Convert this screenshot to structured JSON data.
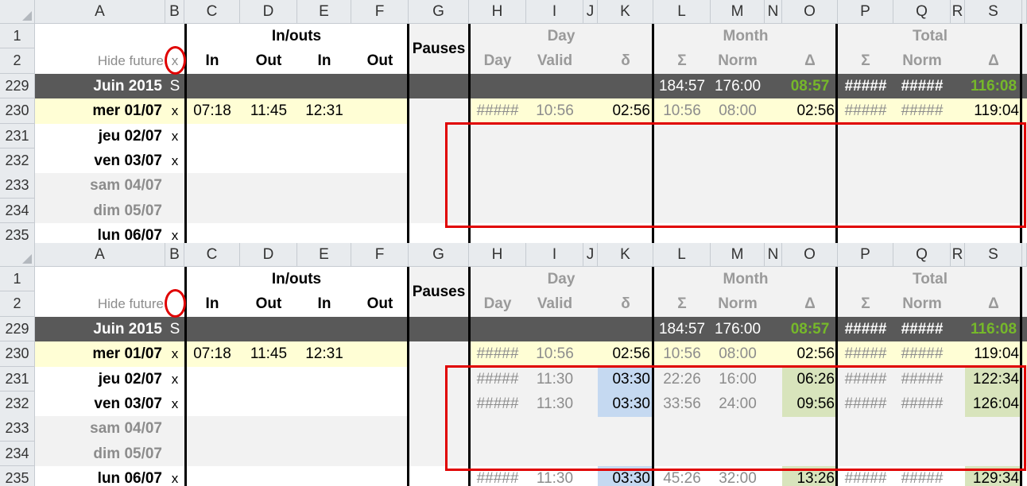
{
  "colors": {
    "header_bg": "#e8ebee",
    "dark_row": "#595959",
    "yellow_row": "#fffed5",
    "weekend_row": "#f2f2f2",
    "blue_cell": "#c5d9f1",
    "green_cell": "#d8e4bc",
    "green_text": "#76b82a",
    "highlight_red": "#e00000"
  },
  "columns": [
    "A",
    "B",
    "C",
    "D",
    "E",
    "F",
    "G",
    "H",
    "I",
    "J",
    "K",
    "L",
    "M",
    "N",
    "O",
    "P",
    "Q",
    "R",
    "S"
  ],
  "header": {
    "inouts": "In/outs",
    "pauses": "Pauses",
    "day": "Day",
    "month": "Month",
    "total": "Total",
    "hide_future": "Hide future",
    "in": "In",
    "out": "Out",
    "day_col": "Day",
    "valid": "Valid",
    "delta_small": "δ",
    "sigma": "Σ",
    "norm": "Norm",
    "delta": "Δ"
  },
  "before": {
    "hide_flag": "x",
    "r229": {
      "row": "229",
      "label": "Juin 2015",
      "b": "S",
      "month_sum": "184:57",
      "month_norm": "176:00",
      "month_delta": "08:57",
      "total_sum": "#####",
      "total_norm": "#####",
      "total_delta": "116:08"
    },
    "r230": {
      "row": "230",
      "label": "mer 01/07",
      "b": "x",
      "in1": "07:18",
      "out1": "11:45",
      "in2": "12:31",
      "h": "#####",
      "valid": "10:56",
      "k": "02:56",
      "l": "10:56",
      "m": "08:00",
      "o": "02:56",
      "p": "#####",
      "q": "#####",
      "s": "119:04"
    },
    "r231": {
      "row": "231",
      "label": "jeu 02/07",
      "b": "x"
    },
    "r232": {
      "row": "232",
      "label": "ven 03/07",
      "b": "x"
    },
    "r233": {
      "row": "233",
      "label": "sam 04/07"
    },
    "r234": {
      "row": "234",
      "label": "dim 05/07"
    },
    "r235": {
      "row": "235",
      "label": "lun 06/07",
      "b": "x"
    }
  },
  "after": {
    "hide_flag": "",
    "r229": {
      "row": "229",
      "label": "Juin 2015",
      "b": "S",
      "month_sum": "184:57",
      "month_norm": "176:00",
      "month_delta": "08:57",
      "total_sum": "#####",
      "total_norm": "#####",
      "total_delta": "116:08"
    },
    "r230": {
      "row": "230",
      "label": "mer 01/07",
      "b": "x",
      "in1": "07:18",
      "out1": "11:45",
      "in2": "12:31",
      "h": "#####",
      "valid": "10:56",
      "k": "02:56",
      "l": "10:56",
      "m": "08:00",
      "o": "02:56",
      "p": "#####",
      "q": "#####",
      "s": "119:04"
    },
    "r231": {
      "row": "231",
      "label": "jeu 02/07",
      "b": "x",
      "h": "#####",
      "valid": "11:30",
      "k": "03:30",
      "l": "22:26",
      "m": "16:00",
      "o": "06:26",
      "p": "#####",
      "q": "#####",
      "s": "122:34"
    },
    "r232": {
      "row": "232",
      "label": "ven 03/07",
      "b": "x",
      "h": "#####",
      "valid": "11:30",
      "k": "03:30",
      "l": "33:56",
      "m": "24:00",
      "o": "09:56",
      "p": "#####",
      "q": "#####",
      "s": "126:04"
    },
    "r233": {
      "row": "233",
      "label": "sam 04/07"
    },
    "r234": {
      "row": "234",
      "label": "dim 05/07"
    },
    "r235": {
      "row": "235",
      "label": "lun 06/07",
      "b": "x",
      "h": "#####",
      "valid": "11:30",
      "k": "03:30",
      "l": "45:26",
      "m": "32:00",
      "o": "13:26",
      "p": "#####",
      "q": "#####",
      "s": "129:34"
    }
  }
}
